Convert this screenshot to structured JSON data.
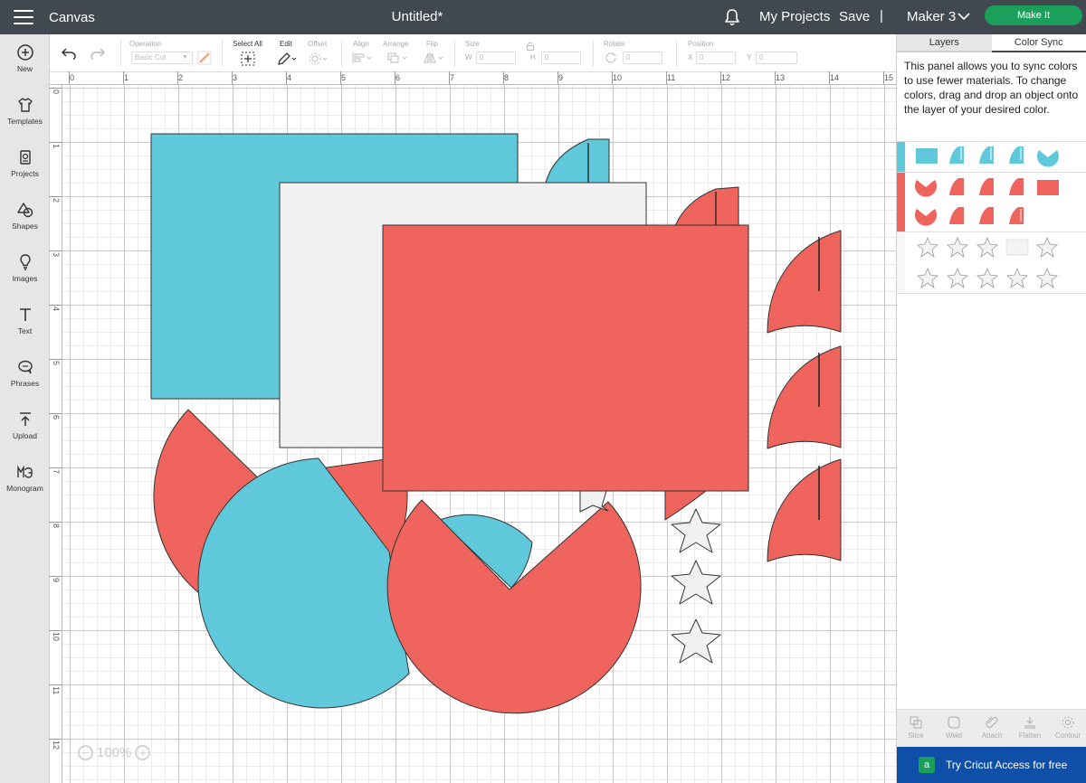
{
  "header": {
    "app_title": "Canvas",
    "document_title": "Untitled*",
    "my_projects": "My Projects",
    "save": "Save",
    "separator": "|",
    "machine": "Maker 3",
    "make_it": "Make It"
  },
  "sidebar": {
    "items": [
      {
        "label": "New",
        "icon": "plus-circle-icon"
      },
      {
        "label": "Templates",
        "icon": "shirt-icon"
      },
      {
        "label": "Projects",
        "icon": "projects-icon"
      },
      {
        "label": "Shapes",
        "icon": "shapes-icon"
      },
      {
        "label": "Images",
        "icon": "lightbulb-icon"
      },
      {
        "label": "Text",
        "icon": "text-icon"
      },
      {
        "label": "Phrases",
        "icon": "speech-bubble-icon"
      },
      {
        "label": "Upload",
        "icon": "upload-icon"
      },
      {
        "label": "Monogram",
        "icon": "monogram-icon"
      }
    ]
  },
  "toolbar": {
    "operation_label": "Operation",
    "operation_value": "Basic Cut",
    "select_all_label": "Select All",
    "edit_label": "Edit",
    "offset_label": "Offset",
    "align_label": "Align",
    "arrange_label": "Arrange",
    "flip_label": "Flip",
    "size_label": "Size",
    "width_label": "W",
    "width_value": "0",
    "height_label": "H",
    "height_value": "0",
    "rotate_label": "Rotate",
    "rotate_value": "0",
    "position_label": "Position",
    "x_label": "X",
    "x_value": "0",
    "y_label": "Y",
    "y_value": "0"
  },
  "ruler": {
    "horizontal": [
      "0",
      "1",
      "2",
      "3",
      "4",
      "5",
      "6",
      "7",
      "8",
      "9",
      "10",
      "11",
      "12",
      "13",
      "14",
      "15"
    ],
    "vertical": [
      "0",
      "1",
      "2",
      "3",
      "4",
      "5",
      "6",
      "7",
      "8",
      "9",
      "10",
      "11",
      "12"
    ]
  },
  "canvas": {
    "zoom_level": "100%",
    "colors": {
      "blue": "#5fc8db",
      "red": "#ef645c",
      "white": "#f1f1f1",
      "outline": "#333333"
    }
  },
  "right_panel": {
    "tab_layers": "Layers",
    "tab_color_sync": "Color Sync",
    "description": "This panel allows you to sync colors to use fewer materials. To change colors, drag and drop an object onto the layer of your desired color.",
    "color_groups": [
      {
        "color": "#5fc8db",
        "count": 5
      },
      {
        "color": "#ef645c",
        "count": 9
      },
      {
        "color": "#f1f1f1",
        "count": 10
      }
    ],
    "tools": [
      "Slice",
      "Weld",
      "Attach",
      "Flatten",
      "Contour"
    ],
    "cricut_access": "Try Cricut Access for free"
  }
}
